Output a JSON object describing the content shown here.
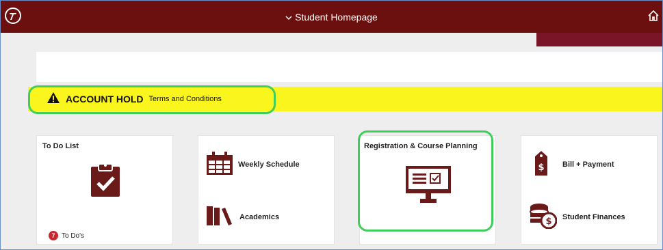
{
  "header": {
    "title": "Student Homepage",
    "logo_icon": "institution-logo-icon",
    "home_icon": "home-icon",
    "bar_color": "#6b0f0f"
  },
  "alert": {
    "title": "ACCOUNT HOLD",
    "link": "Terms and Conditions",
    "icon": "warning-icon",
    "color": "#fbf51e"
  },
  "tiles": {
    "todo": {
      "title": "To Do List",
      "count": "7",
      "count_label": "To Do's",
      "icon": "clipboard-check-icon"
    },
    "schedule": {
      "items": [
        {
          "label": "Weekly Schedule",
          "icon": "calendar-icon"
        },
        {
          "label": "Academics",
          "icon": "books-icon"
        }
      ]
    },
    "registration": {
      "title": "Registration & Course Planning",
      "icon": "monitor-checklist-icon"
    },
    "finances": {
      "items": [
        {
          "label": "Bill + Payment",
          "icon": "price-tag-dollar-icon"
        },
        {
          "label": "Student Finances",
          "icon": "coins-dollar-icon"
        }
      ]
    }
  },
  "colors": {
    "brand": "#6b0f0f",
    "icon": "#6b1a1a",
    "highlight": "#3fce5b"
  }
}
